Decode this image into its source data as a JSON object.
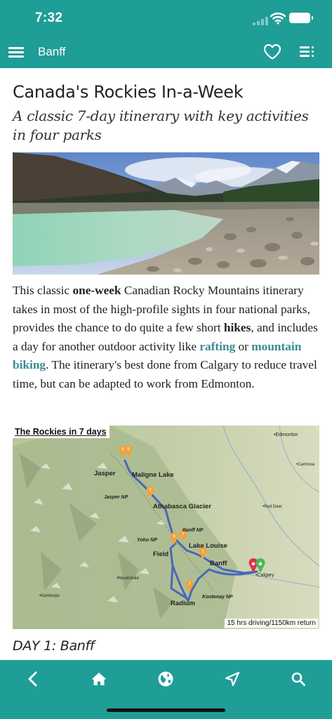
{
  "status_bar": {
    "time": "7:32"
  },
  "nav": {
    "title": "Banff"
  },
  "article": {
    "title": "Canada's Rockies In-a-Week",
    "subtitle": "A classic 7-day itinerary with key activities in four parks",
    "body": {
      "p1": "This classic ",
      "b1": "one-week",
      "p2": " Canadian Rocky Mountains itinerary takes in most of the high-profile sights in four national parks, provides the chance to do quite a few short ",
      "b2": "hikes",
      "p3": ", and includes a day for another outdoor activity like ",
      "link1": "rafting",
      "p4": " or ",
      "link2": "mountain biking",
      "p5": ". The itinerary's best done from Calgary to reduce travel time, but can be adapted to work from Edmonton."
    },
    "day_heading": "DAY 1: Banff"
  },
  "map": {
    "title": "The Rockies in 7 days",
    "footer": "15 hrs driving/1150km return",
    "places": {
      "edmonton": "•Edmonton",
      "camrose": "•Camrose",
      "red_deer": "•Red Deer",
      "jasper": "Jasper",
      "maligne_lake": "Maligne Lake",
      "jasper_np": "Jasper NP",
      "athabasca": "Athabasca Glacier",
      "banff_np": "Banff NP",
      "yoho_np": "Yoho NP",
      "lake_louise": "Lake Louise",
      "field": "Field",
      "banff": "Banff",
      "calgary": "•Calgary",
      "revelstoke": "•Revelstoke",
      "kamloops": "•Kamloops",
      "kootenay_np": "Kootenay NP",
      "radium": "Radium"
    },
    "markers": {
      "m1": "1",
      "m2": "2",
      "m3": "3",
      "m4": "4",
      "m5": "5",
      "m6": "6",
      "m7": "7"
    }
  },
  "bottom_bar": {
    "back_icon": "chevron-left-icon",
    "home_icon": "home-icon",
    "globe_icon": "globe-icon",
    "navigate_icon": "navigation-arrow-icon",
    "search_icon": "search-icon"
  },
  "colors": {
    "brand": "#1f9d97",
    "link": "#3a8a95",
    "route": "#4a67b8",
    "marker": "#f0a43a"
  }
}
